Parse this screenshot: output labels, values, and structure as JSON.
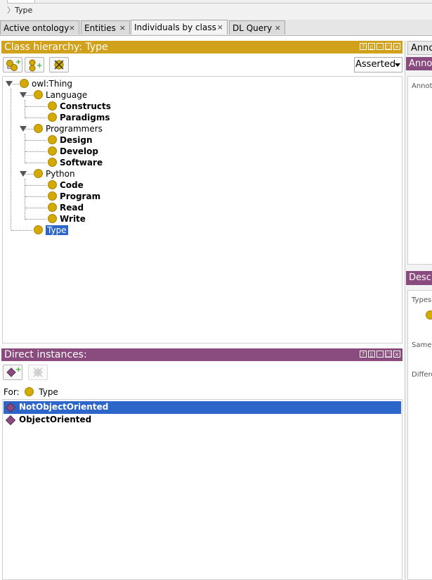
{
  "breadcrumb": {
    "label": "Type"
  },
  "tabs": [
    {
      "label": "Active ontology",
      "close": "×"
    },
    {
      "label": "Entities",
      "close": "×"
    },
    {
      "label": "Individuals by class",
      "close": "×"
    },
    {
      "label": "DL Query",
      "close": "×"
    }
  ],
  "class_hierarchy": {
    "title": "Class hierarchy: Type",
    "mode": "Asserted",
    "tree": {
      "root": "owl:Thing",
      "language": "Language",
      "language_children": [
        "Constructs",
        "Paradigms"
      ],
      "programmers": "Programmers",
      "programmers_children": [
        "Design",
        "Develop",
        "Software"
      ],
      "python": "Python",
      "python_children": [
        "Code",
        "Program",
        "Read",
        "Write"
      ],
      "type": "Type"
    }
  },
  "direct_instances": {
    "title": "Direct instances:",
    "for_label": "For:",
    "for_class": "Type",
    "items": [
      "NotObjectOriented",
      "ObjectOriented"
    ]
  },
  "right": {
    "annotations_tab": "Annot",
    "annotations_header": "Anno",
    "annotations_label": "Annot",
    "description_header": "Desc",
    "types_label": "Types",
    "same_label": "Same",
    "different_label": "Differe"
  },
  "colors": {
    "gold": "#d1a11b",
    "purple": "#8a4b7f",
    "selection": "#2b66c8"
  }
}
